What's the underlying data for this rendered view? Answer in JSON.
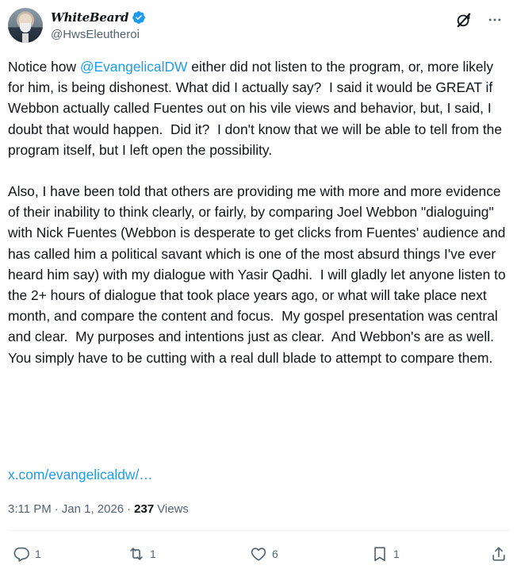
{
  "author": {
    "display_name": "WhiteBeard",
    "handle": "@HwsEleutheroi",
    "verified_icon": "verified-badge-icon"
  },
  "header_actions": {
    "grok_icon": "grok-icon",
    "more_icon": "more-icon"
  },
  "post": {
    "p1_a": "Notice how ",
    "mention": "@EvangelicalDW",
    "p1_b": " either did not listen to the program, or, more likely for him, is being dishonest. What did I actually say?  I said it would be GREAT if Webbon actually called Fuentes out on his vile views and behavior, but, I said, I doubt that would happen.  Did it?  I don't know that we will be able to tell from the program itself, but I left open the possibility.",
    "p2": "Also, I have been told that others are providing me with more and more evidence of their inability to think clearly, or fairly, by comparing Joel Webbon \"dialoguing\" with Nick Fuentes (Webbon is desperate to get clicks from Fuentes' audience and has called him a political savant which is one of the most absurd things I've ever heard him say) with my dialogue with Yasir Qadhi.  I will gladly let anyone listen to the 2+ hours of dialogue that took place years ago, or what will take place next month, and compare the content and focus.  My gospel presentation was central and clear.  My purposes and intentions just as clear.  And Webbon's are as well. You simply have to be cutting with a real dull blade to attempt to compare them.",
    "link": "x.com/evangelicaldw/…"
  },
  "meta": {
    "time": "3:11 PM",
    "sep1": "·",
    "date": "Jan 1, 2026",
    "sep2": "·",
    "views_count": "237",
    "views_label": "Views"
  },
  "actions": {
    "reply_count": "1",
    "repost_count": "1",
    "like_count": "6",
    "bookmark_count": "1"
  },
  "colors": {
    "accent": "#1d9bf0",
    "text": "#0f1419",
    "secondary": "#536471"
  }
}
